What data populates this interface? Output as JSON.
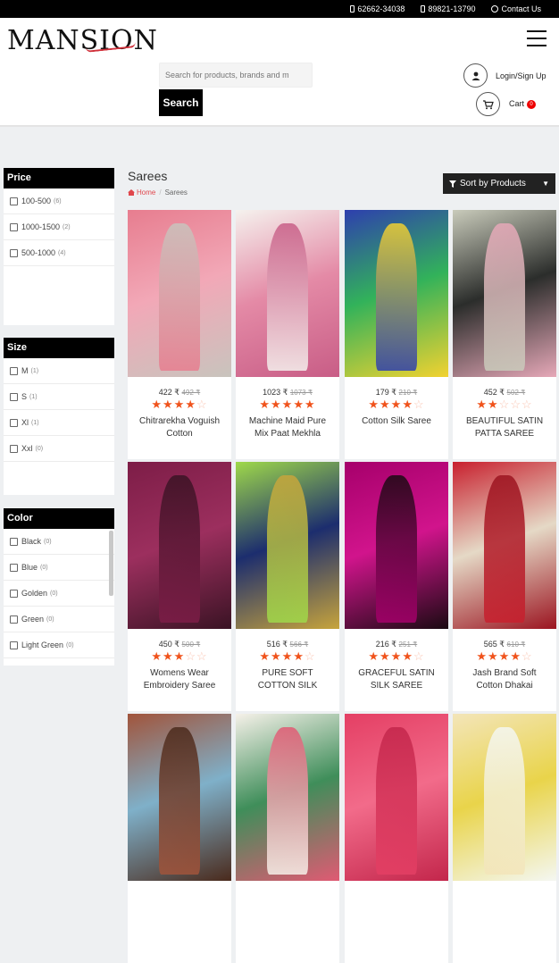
{
  "topbar": {
    "phone1": "62662-34038",
    "phone2": "89821-13790",
    "contact": "Contact Us"
  },
  "header": {
    "logo": "MANSION",
    "search_placeholder": "Search for products, brands and m",
    "search_button": "Search",
    "login": "Login/Sign Up",
    "cart": "Cart",
    "cart_count": "0"
  },
  "filters": {
    "price": {
      "title": "Price",
      "items": [
        {
          "label": "100-500",
          "count": "(6)"
        },
        {
          "label": "1000-1500",
          "count": "(2)"
        },
        {
          "label": "500-1000",
          "count": "(4)"
        }
      ]
    },
    "size": {
      "title": "Size",
      "items": [
        {
          "label": "M",
          "count": "(1)"
        },
        {
          "label": "S",
          "count": "(1)"
        },
        {
          "label": "Xl",
          "count": "(1)"
        },
        {
          "label": "Xxl",
          "count": "(0)"
        }
      ]
    },
    "color": {
      "title": "Color",
      "items": [
        {
          "label": "Black",
          "count": "(0)"
        },
        {
          "label": "Blue",
          "count": "(0)"
        },
        {
          "label": "Golden",
          "count": "(0)"
        },
        {
          "label": "Green",
          "count": "(0)"
        },
        {
          "label": "Light Green",
          "count": "(0)"
        }
      ]
    }
  },
  "main": {
    "title": "Sarees",
    "breadcrumb_home": "Home",
    "breadcrumb_sep": "/",
    "breadcrumb_current": "Sarees",
    "sort_label": "Sort by Products"
  },
  "products": [
    {
      "name": "Chitrarekha Voguish Cotton",
      "price": "422 ₹",
      "old_price": "492 ₹",
      "rating": 4,
      "colors": [
        "#e77d8f",
        "#f2a8b7",
        "#c8c4bd"
      ]
    },
    {
      "name": "Machine Maid Pure Mix Paat Mekhla",
      "price": "1023 ₹",
      "old_price": "1073 ₹",
      "rating": 5,
      "colors": [
        "#f5f2ee",
        "#e48aa6",
        "#c85d86"
      ]
    },
    {
      "name": "Cotton Silk Saree",
      "price": "179 ₹",
      "old_price": "210 ₹",
      "rating": 4,
      "colors": [
        "#2e3fae",
        "#32b25a",
        "#f2d230"
      ]
    },
    {
      "name": "BEAUTIFUL SATIN PATTA SAREE",
      "price": "452 ₹",
      "old_price": "502 ₹",
      "rating": 2,
      "colors": [
        "#c9cbbb",
        "#2b2d2b",
        "#e6a8b8"
      ]
    },
    {
      "name": "Womens Wear Embroidery Saree",
      "price": "450 ₹",
      "old_price": "500 ₹",
      "rating": 3,
      "colors": [
        "#7d1d47",
        "#9c2f5e",
        "#3a1324"
      ]
    },
    {
      "name": "PURE SOFT COTTON SILK",
      "price": "516 ₹",
      "old_price": "566 ₹",
      "rating": 4,
      "colors": [
        "#9fd94a",
        "#1c2d6e",
        "#c7a43c"
      ]
    },
    {
      "name": "GRACEFUL SATIN SILK SAREE",
      "price": "216 ₹",
      "old_price": "251 ₹",
      "rating": 4,
      "colors": [
        "#a6006b",
        "#d1148c",
        "#1a0a12"
      ]
    },
    {
      "name": "Jash Brand Soft Cotton Dhakai",
      "price": "565 ₹",
      "old_price": "610 ₹",
      "rating": 4,
      "colors": [
        "#c8202e",
        "#e5d9c6",
        "#9b1420"
      ]
    },
    {
      "name": "",
      "price": "",
      "old_price": "",
      "rating": 0,
      "colors": [
        "#a1543b",
        "#7fb0c9",
        "#4a2a1c"
      ]
    },
    {
      "name": "",
      "price": "",
      "old_price": "",
      "rating": 0,
      "colors": [
        "#f6f1e9",
        "#3f8e5a",
        "#e05a73"
      ]
    },
    {
      "name": "",
      "price": "",
      "old_price": "",
      "rating": 0,
      "colors": [
        "#e43f64",
        "#f26b8a",
        "#c3264b"
      ]
    },
    {
      "name": "",
      "price": "",
      "old_price": "",
      "rating": 0,
      "colors": [
        "#f3e5b9",
        "#e9d44a",
        "#f4f7f2"
      ]
    }
  ]
}
